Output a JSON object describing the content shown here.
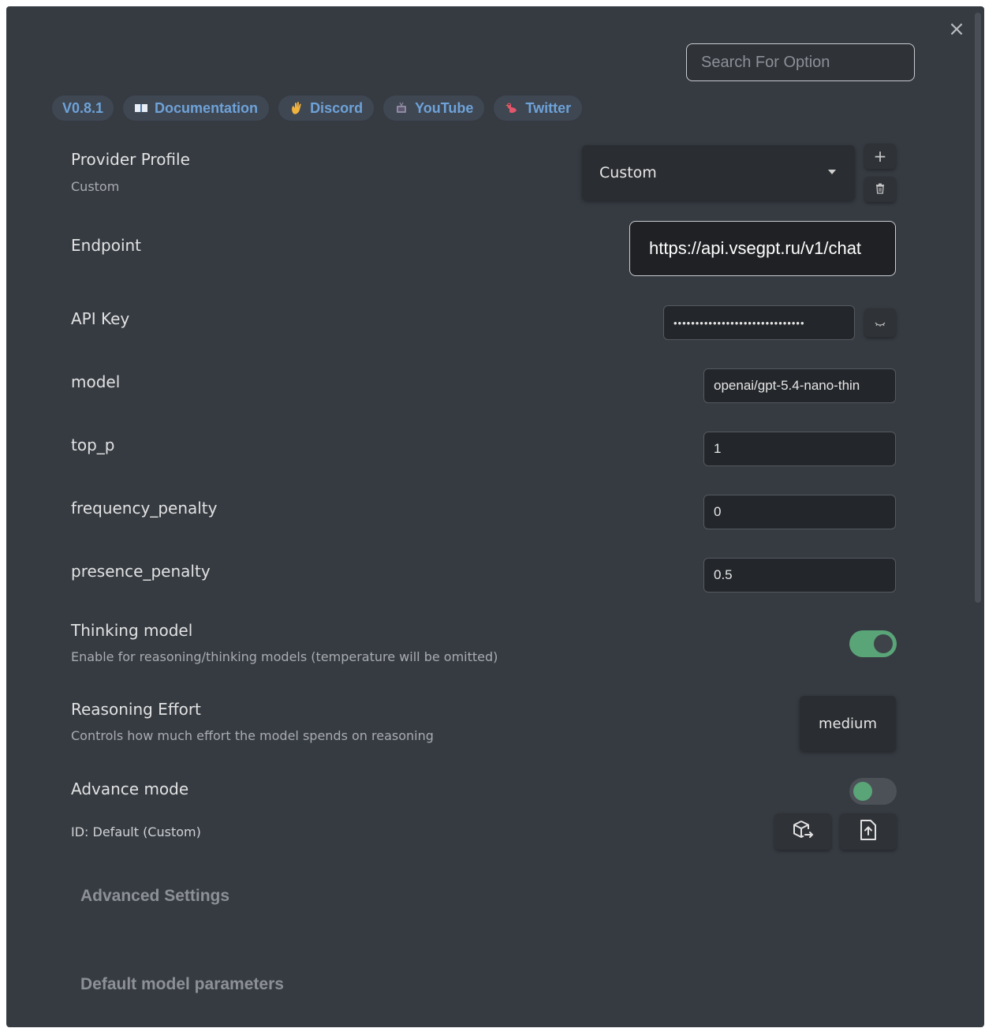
{
  "search": {
    "placeholder": "Search For Option"
  },
  "links": {
    "version": "V0.8.1",
    "documentation": "Documentation",
    "discord": "Discord",
    "youtube": "YouTube",
    "twitter": "Twitter"
  },
  "provider_profile": {
    "label": "Provider Profile",
    "description": "Custom",
    "selected": "Custom",
    "add_label": "+"
  },
  "endpoint": {
    "label": "Endpoint",
    "value": "https://api.vsegpt.ru/v1/chat"
  },
  "api_key": {
    "label": "API Key",
    "value": "••••••••••••••••••••••••••••••"
  },
  "model": {
    "label": "model",
    "value": "openai/gpt-5.4-nano-thin"
  },
  "top_p": {
    "label": "top_p",
    "value": "1"
  },
  "frequency_penalty": {
    "label": "frequency_penalty",
    "value": "0"
  },
  "presence_penalty": {
    "label": "presence_penalty",
    "value": "0.5"
  },
  "thinking_model": {
    "label": "Thinking model",
    "description": "Enable for reasoning/thinking models (temperature will be omitted)",
    "enabled": true
  },
  "reasoning_effort": {
    "label": "Reasoning Effort",
    "description": "Controls how much effort the model spends on reasoning",
    "value": "medium"
  },
  "advance_mode": {
    "label": "Advance mode",
    "enabled": false
  },
  "profile_id": {
    "text": "ID: Default (Custom)"
  },
  "sections": {
    "advanced_settings": "Advanced Settings",
    "default_model_parameters": "Default model parameters"
  },
  "colors": {
    "panel_bg": "#363b42",
    "badge_bg": "#3f4753",
    "badge_text": "#6ea2d8",
    "toggle_on": "#5aa578",
    "input_bg": "#23262a"
  }
}
